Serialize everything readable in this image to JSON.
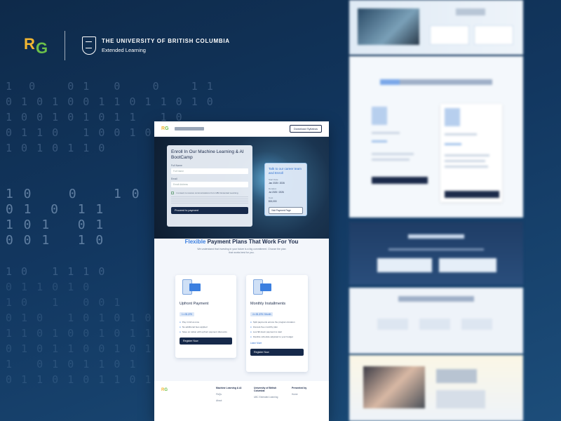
{
  "brand": {
    "rg_r": "R",
    "rg_g": "G",
    "ubc_line1": "THE UNIVERSITY OF BRITISH COLUMBIA",
    "ubc_line2": "Extended Learning"
  },
  "binary_rows": [
    "1  0    0 1   0    0    1 1",
    "0 1 0 1 0 0 1 1 0 1 1 0 1 0 0 1",
    "1 0 0 1 0 1 0 1 1   1 0",
    "0 1 1 0   1 0 0 1 0",
    "1 0 1 0 1 1 0",
    "",
    "",
    "1 0    0    1 0",
    "0 1  0  1 1",
    "1 0 1   0 1",
    "0 0 1   1 0",
    "",
    "1 0   1 1 1 0",
    "0 1 1 0 1 0",
    "1 0   1   0 0 1",
    "0 1 0   1 0 1 0 1 0",
    "1 1 0 1 0 0 1 0 1 1 0",
    "0 1 0 1 1 0 0 1 0 1",
    "1   0 1 0 1 1 0 1",
    "0 1 1 0 1 0 1 1 0 1"
  ],
  "mock": {
    "nav": {
      "download_label": "Download Syllabus"
    },
    "enroll": {
      "heading": "Enroll In Our Machine Learning & AI BootCamp",
      "field1_label": "Full Name",
      "field1_placeholder": "Full Name",
      "field2_label": "Email",
      "field2_placeholder": "Email Address",
      "consent": "I consent to receive communications from UBC Extended Learning",
      "submit": "Proceed to payment"
    },
    "talk": {
      "heading": "Talk to our career team and Enroll",
      "k1": "Start Date",
      "v1": "Jan 2025 / 2026",
      "k2": "Duration",
      "v2": "Jul 2025 / 2026",
      "k3": "Cost",
      "v3": "$15,000",
      "btn": "Visit Payment Page"
    },
    "plans": {
      "title_hl": "Flexible",
      "title_rest": " Payment Plans That Work For You",
      "sub": "We understand that investing in your future is a big commitment. Choose the plan that works best for you."
    },
    "upfront": {
      "title": "Upfront Payment",
      "tag": "1 x $1,875",
      "items": [
        "Pay in full at once",
        "No additional fees applied",
        "Save on tuition with upfront payment discounts"
      ],
      "btn": "Register Now"
    },
    "monthly": {
      "title": "Monthly Installments",
      "tag": "4 x $1,875 / Month",
      "items": [
        "Split payments across the program duration",
        "Interest-free monthly plan",
        "Low $0 down payment to start",
        "Flexible schedule adjusted to your budget"
      ],
      "link": "Learn More",
      "btn": "Register Now"
    },
    "footer": {
      "col1_h": "Machine Learning & AI",
      "col1_items": [
        "FAQs",
        "About"
      ],
      "col2_h": "University of British Columbia",
      "col2_items": [
        "UBC Extended Learning"
      ],
      "col3_h": "Presented by",
      "col3_items": [
        "Home"
      ]
    }
  },
  "colors": {
    "bg_dark": "#0e2a4a",
    "brand_gold": "#f2b632",
    "brand_green": "#6cc04a",
    "accent_blue": "#3b7fe0",
    "button_navy": "#16294a"
  }
}
